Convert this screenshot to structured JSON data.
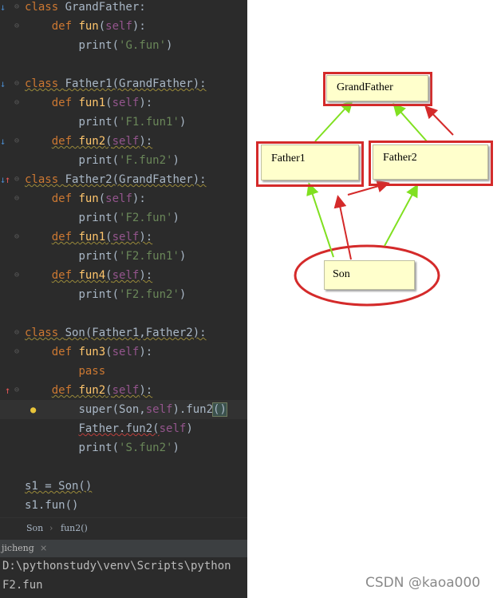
{
  "editor": {
    "lines": [
      {
        "parts": [
          [
            "kw",
            "class "
          ],
          [
            "cls",
            "GrandFather:"
          ]
        ]
      },
      {
        "parts": [
          [
            "pad",
            "    "
          ],
          [
            "kw",
            "def "
          ],
          [
            "fn",
            "fun"
          ],
          [
            "cls",
            "("
          ],
          [
            "self",
            "self"
          ],
          [
            "cls",
            "):"
          ]
        ]
      },
      {
        "parts": [
          [
            "pad",
            "        "
          ],
          [
            "cls",
            "print("
          ],
          [
            "str",
            "'G.fun'"
          ],
          [
            "cls",
            ")"
          ]
        ]
      },
      {
        "parts": []
      },
      {
        "parts": [
          [
            "kw",
            "class "
          ],
          [
            "cls",
            "Father1(GrandFather):"
          ]
        ]
      },
      {
        "parts": [
          [
            "pad",
            "    "
          ],
          [
            "kw",
            "def "
          ],
          [
            "fn",
            "fun1"
          ],
          [
            "cls",
            "("
          ],
          [
            "self",
            "self"
          ],
          [
            "cls",
            "):"
          ]
        ]
      },
      {
        "parts": [
          [
            "pad",
            "        "
          ],
          [
            "cls",
            "print("
          ],
          [
            "str",
            "'F1.fun1'"
          ],
          [
            "cls",
            ")"
          ]
        ]
      },
      {
        "parts": [
          [
            "pad",
            "    "
          ],
          [
            "kw",
            "def "
          ],
          [
            "fn",
            "fun2"
          ],
          [
            "cls",
            "("
          ],
          [
            "self",
            "self"
          ],
          [
            "cls",
            "):"
          ]
        ]
      },
      {
        "parts": [
          [
            "pad",
            "        "
          ],
          [
            "cls",
            "print("
          ],
          [
            "str",
            "'F.fun2'"
          ],
          [
            "cls",
            ")"
          ]
        ]
      },
      {
        "parts": [
          [
            "kw",
            "class "
          ],
          [
            "cls",
            "Father2(GrandFather):"
          ]
        ]
      },
      {
        "parts": [
          [
            "pad",
            "    "
          ],
          [
            "kw",
            "def "
          ],
          [
            "fn",
            "fun"
          ],
          [
            "cls",
            "("
          ],
          [
            "self",
            "self"
          ],
          [
            "cls",
            "):"
          ]
        ]
      },
      {
        "parts": [
          [
            "pad",
            "        "
          ],
          [
            "cls",
            "print("
          ],
          [
            "str",
            "'F2.fun'"
          ],
          [
            "cls",
            ")"
          ]
        ]
      },
      {
        "parts": [
          [
            "pad",
            "    "
          ],
          [
            "kw",
            "def "
          ],
          [
            "fn",
            "fun1"
          ],
          [
            "cls",
            "("
          ],
          [
            "self",
            "self"
          ],
          [
            "cls",
            "):"
          ]
        ]
      },
      {
        "parts": [
          [
            "pad",
            "        "
          ],
          [
            "cls",
            "print("
          ],
          [
            "str",
            "'F2.fun1'"
          ],
          [
            "cls",
            ")"
          ]
        ]
      },
      {
        "parts": [
          [
            "pad",
            "    "
          ],
          [
            "kw",
            "def "
          ],
          [
            "fn",
            "fun4"
          ],
          [
            "cls",
            "("
          ],
          [
            "self",
            "self"
          ],
          [
            "cls",
            "):"
          ]
        ]
      },
      {
        "parts": [
          [
            "pad",
            "        "
          ],
          [
            "cls",
            "print("
          ],
          [
            "str",
            "'F2.fun2'"
          ],
          [
            "cls",
            ")"
          ]
        ]
      },
      {
        "parts": []
      },
      {
        "parts": [
          [
            "kw",
            "class "
          ],
          [
            "cls",
            "Son(Father1,Father2):"
          ]
        ]
      },
      {
        "parts": [
          [
            "pad",
            "    "
          ],
          [
            "kw",
            "def "
          ],
          [
            "fn",
            "fun3"
          ],
          [
            "cls",
            "("
          ],
          [
            "self",
            "self"
          ],
          [
            "cls",
            "):"
          ]
        ]
      },
      {
        "parts": [
          [
            "pad",
            "        "
          ],
          [
            "kw",
            "pass"
          ]
        ]
      },
      {
        "parts": [
          [
            "pad",
            "    "
          ],
          [
            "kw",
            "def "
          ],
          [
            "fn",
            "fun2"
          ],
          [
            "cls",
            "("
          ],
          [
            "self",
            "self"
          ],
          [
            "cls",
            "):"
          ]
        ]
      },
      {
        "parts": [
          [
            "pad",
            "        "
          ],
          [
            "cls",
            "super(Son,"
          ],
          [
            "self",
            "self"
          ],
          [
            "cls",
            ").fun2"
          ],
          [
            "brk",
            "()"
          ]
        ]
      },
      {
        "parts": [
          [
            "pad",
            "        "
          ],
          [
            "cls",
            "Father.fun2("
          ],
          [
            "self",
            "self"
          ],
          [
            "cls",
            ")"
          ]
        ]
      },
      {
        "parts": [
          [
            "pad",
            "        "
          ],
          [
            "cls",
            "print("
          ],
          [
            "str",
            "'S.fun2'"
          ],
          [
            "cls",
            ")"
          ]
        ]
      },
      {
        "parts": []
      },
      {
        "parts": [
          [
            "cls",
            "s1 = Son()"
          ]
        ]
      },
      {
        "parts": [
          [
            "cls",
            "s1.fun()"
          ]
        ]
      }
    ]
  },
  "breadcrumb": {
    "item1": "Son",
    "sep": "›",
    "item2": "fun2()"
  },
  "run_tab": {
    "name": "jicheng",
    "close": "×"
  },
  "console": {
    "line1": "D:\\pythonstudy\\venv\\Scripts\\python",
    "line2": "F2.fun"
  },
  "diagram": {
    "grandfather": "GrandFather",
    "father1": "Father1",
    "father2": "Father2",
    "son": "Son",
    "green": "#80e020",
    "red": "#d42a2a"
  },
  "watermark": "CSDN @kaoa000"
}
